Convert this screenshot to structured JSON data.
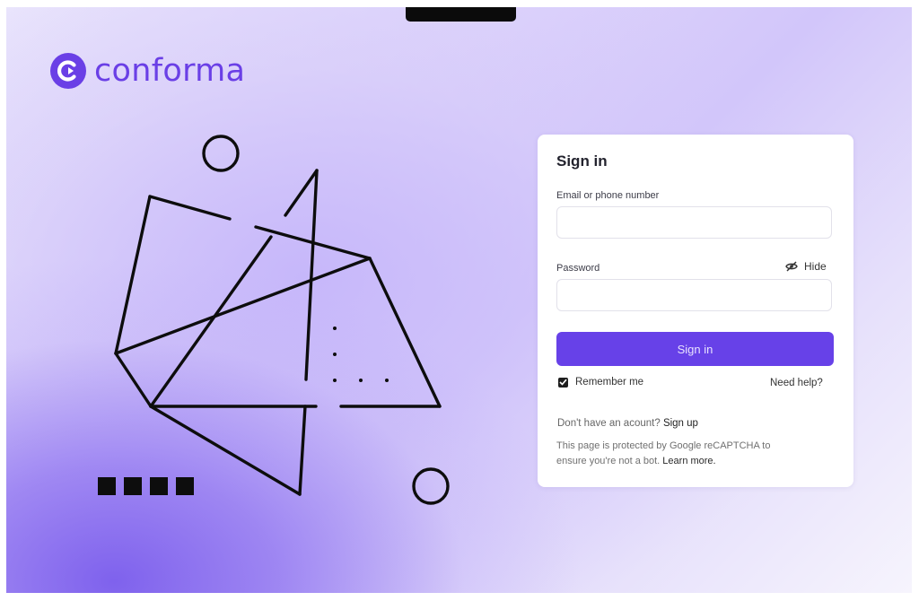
{
  "brand": {
    "name": "conforma",
    "color": "#6a3fe6",
    "icon": "conforma-logo-icon"
  },
  "signin": {
    "title": "Sign in",
    "email_label": "Email or phone number",
    "email_value": "",
    "password_label": "Password",
    "password_value": "",
    "hide_label": "Hide",
    "hide_icon": "eye-slash-icon",
    "submit_label": "Sign in",
    "button_color": "#6741e8",
    "remember_label": "Remember me",
    "remember_checked": true,
    "help_label": "Need help?",
    "signup_prompt": "Don't have an acount?",
    "signup_link": "Sign up",
    "captcha_text": "This page is protected by Google reCAPTCHA to ensure you're not a bot.",
    "captcha_link": "Learn more."
  }
}
